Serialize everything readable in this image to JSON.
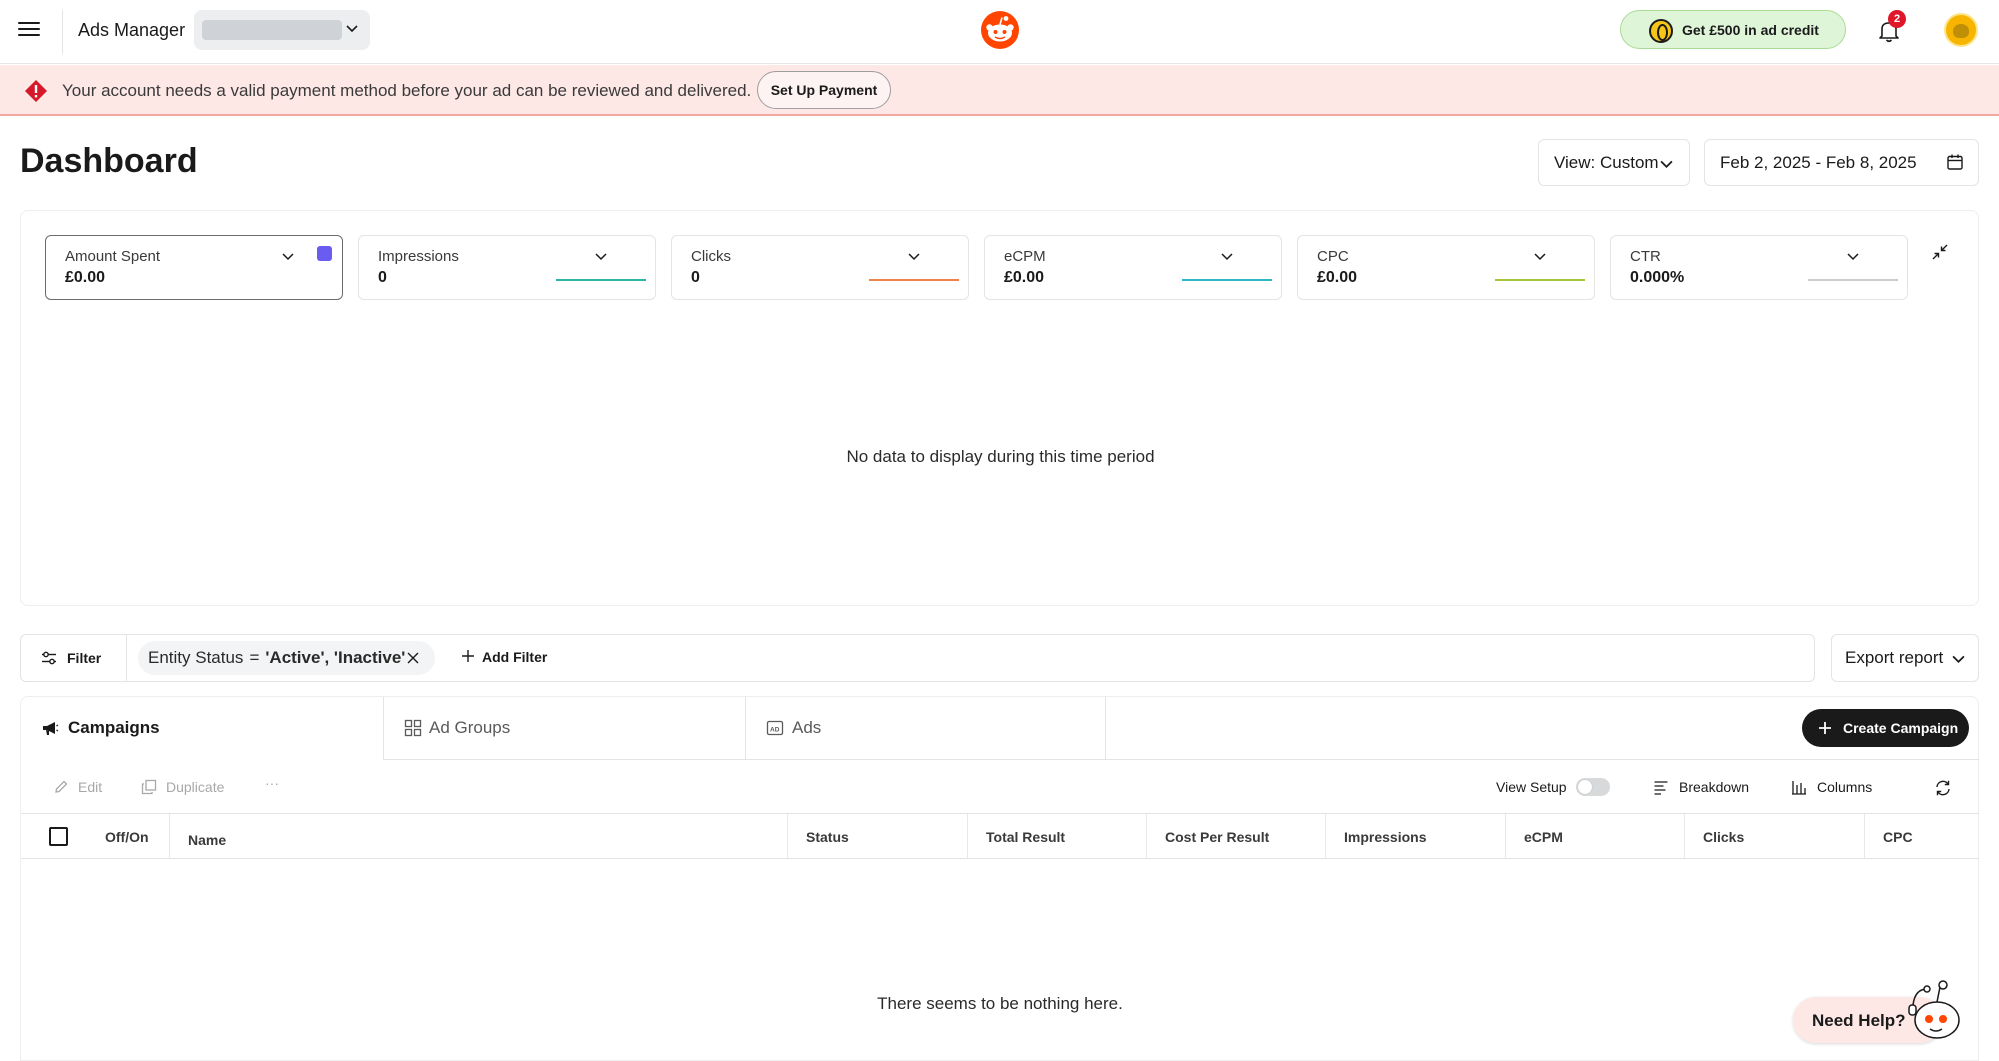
{
  "header": {
    "app_title": "Ads Manager",
    "credit_label": "Get £500 in ad credit",
    "notification_count": "2"
  },
  "alert": {
    "message": "Your account needs a valid payment method before your ad can be reviewed and delivered.",
    "button_label": "Set Up Payment"
  },
  "dashboard": {
    "title": "Dashboard",
    "view_label": "View: Custom",
    "date_range": "Feb 2, 2025 - Feb 8, 2025",
    "no_data_message": "No data to display during this time period"
  },
  "metrics": [
    {
      "label": "Amount Spent",
      "value": "£0.00",
      "color": "#6a5cf0"
    },
    {
      "label": "Impressions",
      "value": "0",
      "color": "#2bb5a8"
    },
    {
      "label": "Clicks",
      "value": "0",
      "color": "#f0824c"
    },
    {
      "label": "eCPM",
      "value": "£0.00",
      "color": "#2bb8c7"
    },
    {
      "label": "CPC",
      "value": "£0.00",
      "color": "#a6c63a"
    },
    {
      "label": "CTR",
      "value": "0.000%",
      "color": "#c9cbcd"
    }
  ],
  "filters": {
    "filter_label": "Filter",
    "chip_key": "Entity Status",
    "chip_operator": "=",
    "chip_value": "'Active', 'Inactive'",
    "add_filter_label": "Add Filter",
    "export_label": "Export report"
  },
  "tabs": [
    {
      "label": "Campaigns",
      "active": true
    },
    {
      "label": "Ad Groups",
      "active": false
    },
    {
      "label": "Ads",
      "active": false
    }
  ],
  "create_label": "Create Campaign",
  "toolbar": {
    "edit": "Edit",
    "duplicate": "Duplicate",
    "more": "···",
    "view_setup": "View Setup",
    "breakdown": "Breakdown",
    "columns": "Columns"
  },
  "table": {
    "columns": [
      "Off/On",
      "Name",
      "Status",
      "Total Result",
      "Cost Per Result",
      "Impressions",
      "eCPM",
      "Clicks",
      "CPC"
    ],
    "empty_message": "There seems to be nothing here."
  },
  "help_label": "Need Help?"
}
